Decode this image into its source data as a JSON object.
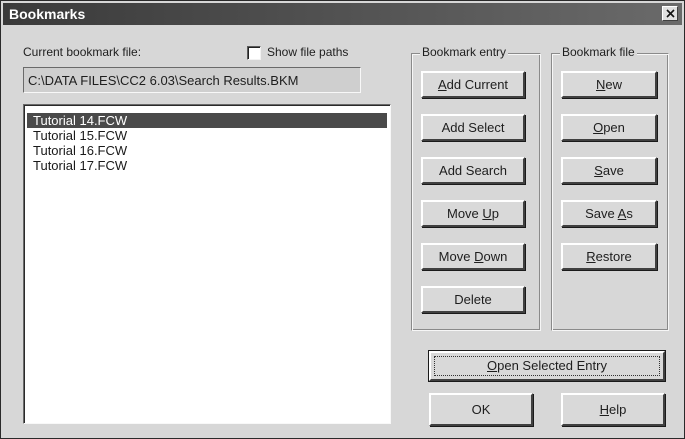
{
  "dialog": {
    "title": "Bookmarks",
    "close_icon": "close-icon"
  },
  "left": {
    "current_file_label": "Current bookmark file:",
    "show_paths_label": "Show file paths",
    "show_paths_checked": false,
    "path_value": "C:\\DATA FILES\\CC2 6.03\\Search Results.BKM",
    "items": [
      {
        "label": "Tutorial 14.FCW",
        "selected": true
      },
      {
        "label": "Tutorial 15.FCW",
        "selected": false
      },
      {
        "label": "Tutorial 16.FCW",
        "selected": false
      },
      {
        "label": "Tutorial 17.FCW",
        "selected": false
      }
    ]
  },
  "entry_group": {
    "label": "Bookmark entry",
    "add_current": {
      "pre": "",
      "key": "A",
      "post": "dd Current"
    },
    "add_select": "Add Select",
    "add_search": "Add Search",
    "move_up": {
      "pre": "Move ",
      "key": "U",
      "post": "p"
    },
    "move_down": {
      "pre": "Move ",
      "key": "D",
      "post": "own"
    },
    "delete": "Delete"
  },
  "file_group": {
    "label": "Bookmark file",
    "new": {
      "pre": "",
      "key": "N",
      "post": "ew"
    },
    "open": {
      "pre": "",
      "key": "O",
      "post": "pen"
    },
    "save": {
      "pre": "",
      "key": "S",
      "post": "ave"
    },
    "save_as": {
      "pre": "Save ",
      "key": "A",
      "post": "s"
    },
    "restore": {
      "pre": "",
      "key": "R",
      "post": "estore"
    }
  },
  "bottom": {
    "open_selected": {
      "pre": "",
      "key": "O",
      "post": "pen Selected Entry"
    },
    "ok": "OK",
    "help": {
      "pre": "",
      "key": "H",
      "post": "elp"
    }
  }
}
